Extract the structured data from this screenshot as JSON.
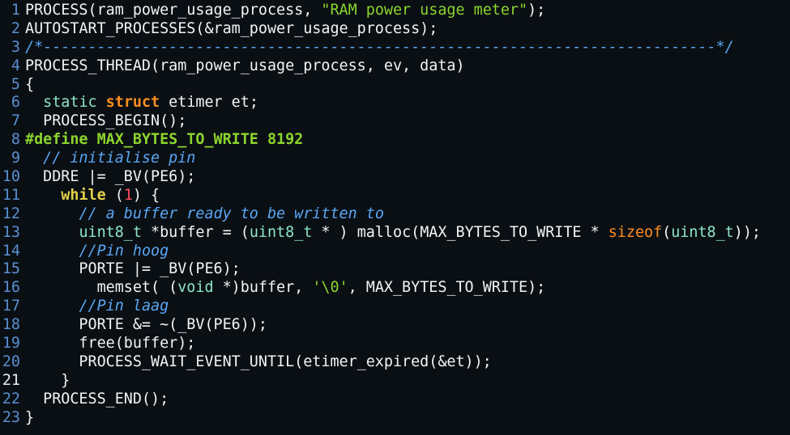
{
  "editor": {
    "cursor_line": 21,
    "colors": {
      "background": "#0a0f14",
      "line_number": "#5a8fd0",
      "plain": "#f2f4f6",
      "string": "#8cd52d",
      "comment": "#5aa7f5",
      "keyword": "#ff8f1f",
      "type": "#8de6c8",
      "preprocessor": "#8cd52d",
      "number": "#ff4b5b",
      "while": "#e3cf4a"
    },
    "lines": [
      {
        "num": "1",
        "tokens": [
          {
            "t": "PROCESS(ram_power_usage_process, ",
            "c": "plain"
          },
          {
            "t": "\"RAM power usage meter\"",
            "c": "str"
          },
          {
            "t": ");",
            "c": "plain"
          }
        ]
      },
      {
        "num": "2",
        "tokens": [
          {
            "t": "AUTOSTART_PROCESSES(&ram_power_usage_process);",
            "c": "plain"
          }
        ]
      },
      {
        "num": "3",
        "tokens": [
          {
            "t": "/*---------------------------------------------------------------------------*/",
            "c": "comment"
          }
        ]
      },
      {
        "num": "4",
        "tokens": [
          {
            "t": "PROCESS_THREAD(ram_power_usage_process, ev, data)",
            "c": "plain"
          }
        ]
      },
      {
        "num": "5",
        "tokens": [
          {
            "t": "{",
            "c": "plain"
          }
        ]
      },
      {
        "num": "6",
        "tokens": [
          {
            "t": "  ",
            "c": "plain"
          },
          {
            "t": "static",
            "c": "type"
          },
          {
            "t": " ",
            "c": "plain"
          },
          {
            "t": "struct",
            "c": "kw"
          },
          {
            "t": " etimer et;",
            "c": "plain"
          }
        ]
      },
      {
        "num": "7",
        "tokens": [
          {
            "t": "  PROCESS_BEGIN();",
            "c": "plain"
          }
        ]
      },
      {
        "num": "8",
        "tokens": [
          {
            "t": "#define MAX_BYTES_TO_WRITE 8192",
            "c": "pre"
          }
        ]
      },
      {
        "num": "9",
        "tokens": [
          {
            "t": "  ",
            "c": "plain"
          },
          {
            "t": "// initialise pin",
            "c": "comment"
          }
        ]
      },
      {
        "num": "10",
        "tokens": [
          {
            "t": "  DDRE |= _BV(PE6);",
            "c": "plain"
          }
        ]
      },
      {
        "num": "11",
        "tokens": [
          {
            "t": "    ",
            "c": "plain"
          },
          {
            "t": "while",
            "c": "keyword2"
          },
          {
            "t": " (",
            "c": "plain"
          },
          {
            "t": "1",
            "c": "num"
          },
          {
            "t": ") {",
            "c": "plain"
          }
        ]
      },
      {
        "num": "12",
        "tokens": [
          {
            "t": "      ",
            "c": "plain"
          },
          {
            "t": "// a buffer ready to be written to",
            "c": "comment"
          }
        ]
      },
      {
        "num": "13",
        "tokens": [
          {
            "t": "      ",
            "c": "plain"
          },
          {
            "t": "uint8_t",
            "c": "type"
          },
          {
            "t": " *buffer = (",
            "c": "plain"
          },
          {
            "t": "uint8_t",
            "c": "type"
          },
          {
            "t": " * ) malloc(MAX_BYTES_TO_WRITE * ",
            "c": "plain"
          },
          {
            "t": "sizeof",
            "c": "func"
          },
          {
            "t": "(",
            "c": "plain"
          },
          {
            "t": "uint8_t",
            "c": "type"
          },
          {
            "t": "));",
            "c": "plain"
          }
        ]
      },
      {
        "num": "14",
        "tokens": [
          {
            "t": "      ",
            "c": "plain"
          },
          {
            "t": "//Pin hoog",
            "c": "comment"
          }
        ]
      },
      {
        "num": "15",
        "tokens": [
          {
            "t": "      PORTE |= _BV(PE6);",
            "c": "plain"
          }
        ]
      },
      {
        "num": "16",
        "tokens": [
          {
            "t": "        memset( (",
            "c": "plain"
          },
          {
            "t": "void",
            "c": "type"
          },
          {
            "t": " *)buffer, ",
            "c": "plain"
          },
          {
            "t": "'\\0'",
            "c": "str"
          },
          {
            "t": ", MAX_BYTES_TO_WRITE);",
            "c": "plain"
          }
        ]
      },
      {
        "num": "17",
        "tokens": [
          {
            "t": "      ",
            "c": "plain"
          },
          {
            "t": "//Pin laag",
            "c": "comment"
          }
        ]
      },
      {
        "num": "18",
        "tokens": [
          {
            "t": "      PORTE &= ~(_BV(PE6));",
            "c": "plain"
          }
        ]
      },
      {
        "num": "19",
        "tokens": [
          {
            "t": "      free(buffer);",
            "c": "plain"
          }
        ]
      },
      {
        "num": "20",
        "tokens": [
          {
            "t": "      PROCESS_WAIT_EVENT_UNTIL(etimer_expired(&et));",
            "c": "plain"
          }
        ]
      },
      {
        "num": "21",
        "tokens": [
          {
            "t": "    }",
            "c": "plain"
          }
        ]
      },
      {
        "num": "22",
        "tokens": [
          {
            "t": "  PROCESS_END();",
            "c": "plain"
          }
        ]
      },
      {
        "num": "23",
        "tokens": [
          {
            "t": "}",
            "c": "plain"
          }
        ]
      }
    ]
  }
}
